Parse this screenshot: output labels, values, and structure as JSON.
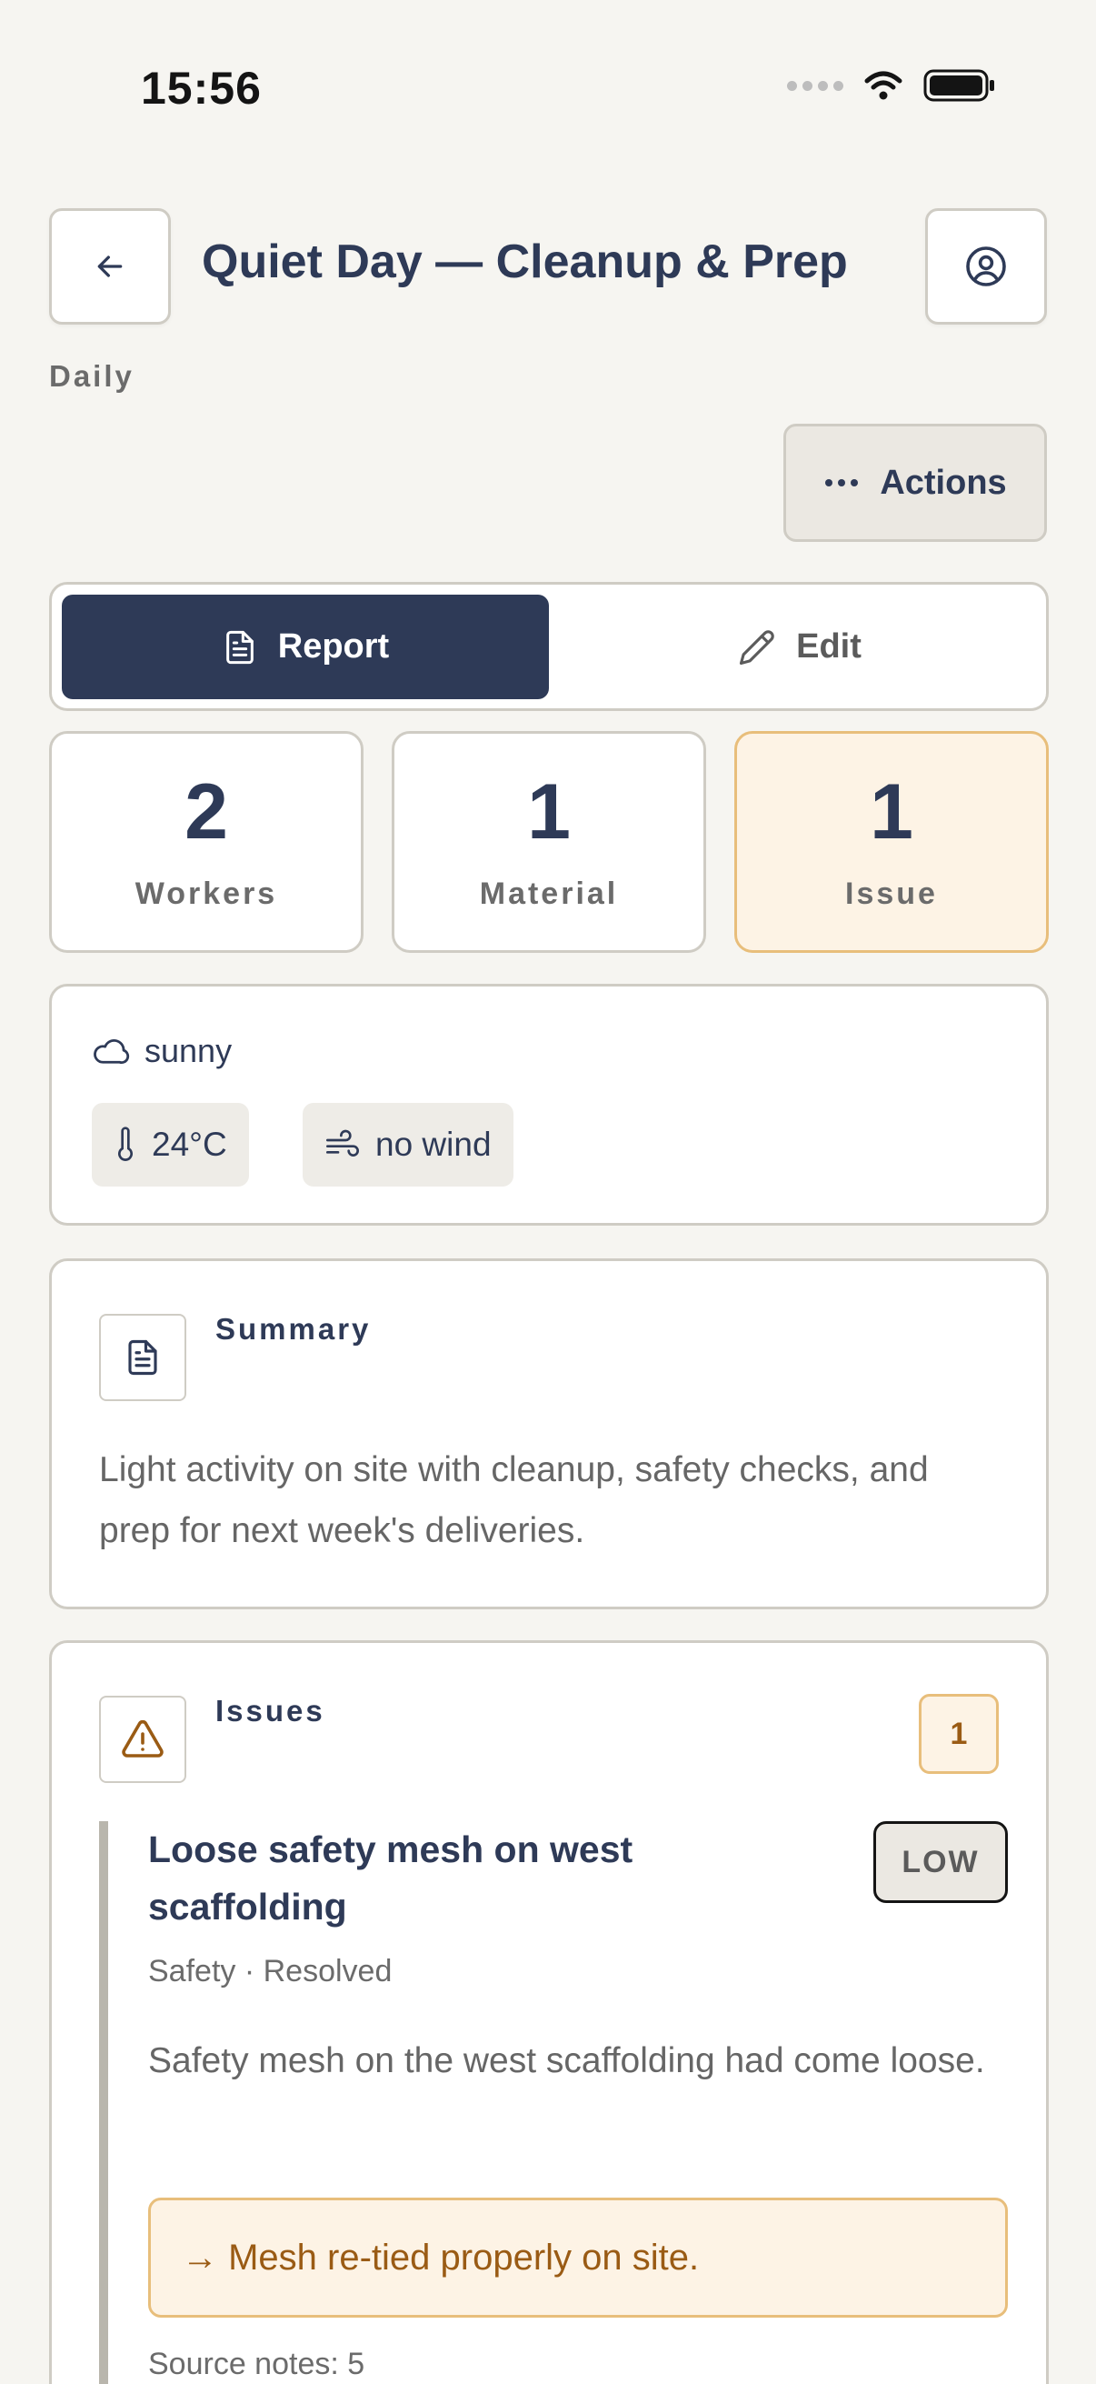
{
  "status_bar": {
    "time": "15:56"
  },
  "header": {
    "title": "Quiet Day — Cleanup & Prep",
    "type": "Daily"
  },
  "actions_label": "Actions",
  "tabs": [
    {
      "label": "Report",
      "active": true
    },
    {
      "label": "Edit",
      "active": false
    }
  ],
  "stats": [
    {
      "value": "2",
      "label": "Workers"
    },
    {
      "value": "1",
      "label": "Material"
    },
    {
      "value": "1",
      "label": "Issue"
    }
  ],
  "weather": {
    "condition": "sunny",
    "temperature": "24°C",
    "wind": "no wind"
  },
  "summary": {
    "heading": "Summary",
    "text": "Light activity on site with cleanup, safety checks, and prep for next week's deliveries."
  },
  "issues": {
    "heading": "Issues",
    "count": "1",
    "items": [
      {
        "title": "Loose safety mesh on west scaffolding",
        "severity": "LOW",
        "meta": "Safety · Resolved",
        "description": "Safety mesh on the west scaffolding had come loose.",
        "resolution": "→ Mesh re-tied properly on site.",
        "source": "Source notes: 5"
      }
    ]
  },
  "colors": {
    "primary": "#2e3a57",
    "background": "#f6f5f1",
    "accent_bg": "#fdf3e5",
    "accent_border": "#e8be7b",
    "accent_text": "#9a5b14"
  }
}
